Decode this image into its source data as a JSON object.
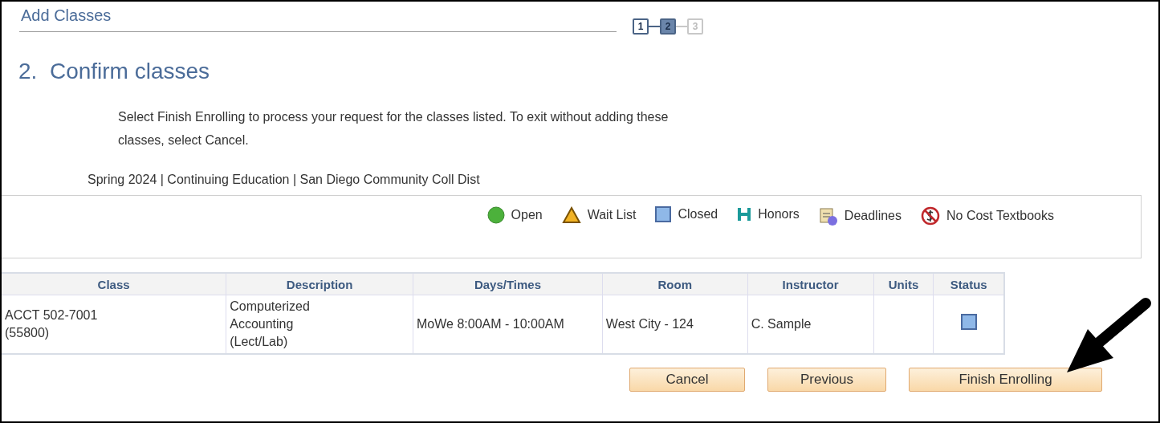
{
  "header": {
    "title": "Add Classes"
  },
  "steps": [
    {
      "label": "1",
      "selected": false,
      "disabled": false
    },
    {
      "label": "2",
      "selected": true,
      "disabled": false
    },
    {
      "label": "3",
      "selected": false,
      "disabled": true
    }
  ],
  "page_title": "2.  Confirm classes",
  "instructions": "Select Finish Enrolling to process your request for the classes listed. To exit without adding these classes, select Cancel.",
  "term": "Spring 2024 | Continuing Education | San Diego Community Coll Dist",
  "legend": [
    {
      "kind": "open",
      "label": "Open"
    },
    {
      "kind": "waitlist",
      "label": "Wait List"
    },
    {
      "kind": "closed",
      "label": "Closed"
    },
    {
      "kind": "honors",
      "label": "Honors"
    },
    {
      "kind": "deadlines",
      "label": "Deadlines"
    },
    {
      "kind": "nocost",
      "label": "No Cost Textbooks"
    }
  ],
  "table": {
    "columns": [
      "Class",
      "Description",
      "Days/Times",
      "Room",
      "Instructor",
      "Units",
      "Status"
    ],
    "rows": [
      {
        "class": "ACCT 502-7001\n(55800)",
        "description": "Computerized\nAccounting\n(Lect/Lab)",
        "days_times": "MoWe 8:00AM - 10:00AM",
        "room": "West City - 124",
        "instructor": "C. Sample",
        "closed": true
      }
    ]
  },
  "buttons": [
    "Cancel",
    "Previous",
    "Finish Enrolling"
  ]
}
